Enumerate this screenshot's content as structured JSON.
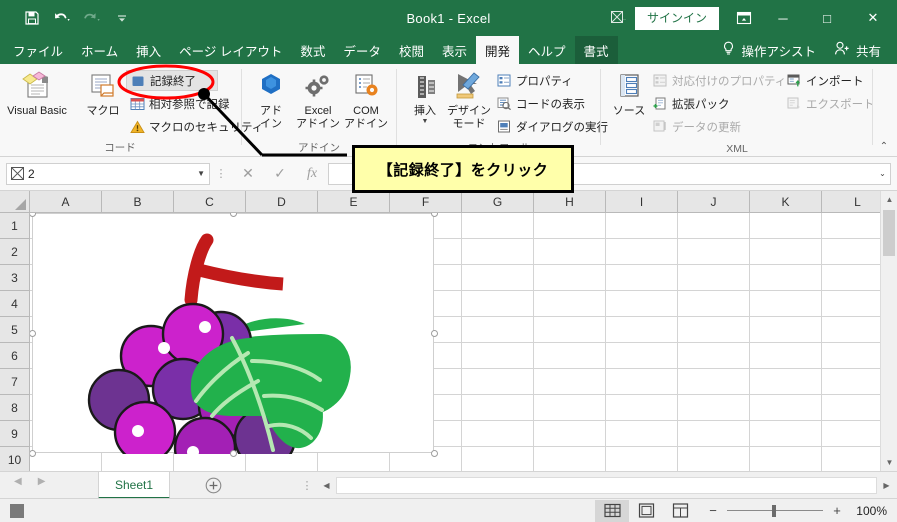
{
  "window": {
    "title": "Book1  -  Excel",
    "signin_label": "サインイン",
    "minimize_label": "─",
    "maximize_label": "□",
    "close_label": "✕",
    "quick_access": [
      {
        "name": "save-icon",
        "tooltip": "上書き保存"
      },
      {
        "name": "undo-icon",
        "tooltip": "元に戻す"
      },
      {
        "name": "redo-icon",
        "tooltip": "やり直し"
      },
      {
        "name": "customize-qat-icon",
        "tooltip": "クイック アクセス ツール バーのユーザー設定"
      }
    ]
  },
  "tabs": [
    {
      "label": "ファイル",
      "active": false
    },
    {
      "label": "ホーム",
      "active": false
    },
    {
      "label": "挿入",
      "active": false
    },
    {
      "label": "ページ レイアウト",
      "active": false
    },
    {
      "label": "数式",
      "active": false
    },
    {
      "label": "データ",
      "active": false
    },
    {
      "label": "校閲",
      "active": false
    },
    {
      "label": "表示",
      "active": false
    },
    {
      "label": "開発",
      "active": true
    },
    {
      "label": "ヘルプ",
      "active": false
    },
    {
      "label": "書式",
      "active": false,
      "contextual": true
    }
  ],
  "tabs_right": {
    "assist_label": "操作アシスト",
    "share_label": "共有"
  },
  "ribbon": {
    "collapse_label": "⌃",
    "groups": [
      {
        "name": "code",
        "label": "コード",
        "big_buttons": [
          {
            "label_line1": "Visual Basic",
            "label_line2": "",
            "icon": "visual-basic-icon"
          },
          {
            "label_line1": "マクロ",
            "label_line2": "",
            "icon": "macro-icon"
          }
        ],
        "small_items": [
          {
            "label": "記録終了",
            "icon": "stop-recording-icon",
            "state": "hover"
          },
          {
            "label": "相対参照で記録",
            "icon": "relative-reference-icon",
            "state": "normal"
          },
          {
            "label": "マクロのセキュリティ",
            "icon": "macro-security-icon",
            "state": "normal"
          }
        ]
      },
      {
        "name": "addins",
        "label": "アドイン",
        "big_buttons": [
          {
            "label_line1": "アド",
            "label_line2": "イン",
            "icon": "addin-icon"
          },
          {
            "label_line1": "Excel",
            "label_line2": "アドイン",
            "icon": "excel-addin-icon"
          },
          {
            "label_line1": "COM",
            "label_line2": "アドイン",
            "icon": "com-addin-icon"
          }
        ],
        "small_items": []
      },
      {
        "name": "controls",
        "label": "コントロール",
        "big_buttons": [
          {
            "label_line1": "挿入",
            "label_line2": "",
            "icon": "insert-control-icon",
            "has_caret": true
          },
          {
            "label_line1": "デザイン",
            "label_line2": "モード",
            "icon": "design-mode-icon"
          }
        ],
        "small_items": [
          {
            "label": "プロパティ",
            "icon": "properties-icon",
            "state": "normal"
          },
          {
            "label": "コードの表示",
            "icon": "view-code-icon",
            "state": "normal"
          },
          {
            "label": "ダイアログの実行",
            "icon": "run-dialog-icon",
            "state": "normal"
          }
        ]
      },
      {
        "name": "xml",
        "label": "XML",
        "big_buttons": [
          {
            "label_line1": "ソース",
            "label_line2": "",
            "icon": "xml-source-icon"
          }
        ],
        "small_items": [
          {
            "label": "対応付けのプロパティ",
            "icon": "map-properties-icon",
            "state": "disabled"
          },
          {
            "label": "拡張パック",
            "icon": "expansion-pack-icon",
            "state": "normal"
          },
          {
            "label": "データの更新",
            "icon": "refresh-data-icon",
            "state": "disabled"
          },
          {
            "label": "インポート",
            "icon": "import-icon",
            "state": "normal"
          },
          {
            "label": "エクスポート",
            "icon": "export-icon",
            "state": "disabled"
          }
        ]
      }
    ]
  },
  "formula_bar": {
    "name_box_value": "2",
    "name_box_icon": "picture-object-icon",
    "cancel_label": "✕",
    "enter_label": "✓",
    "function_label": "fx",
    "formula_value": "",
    "expand_label": "⌄"
  },
  "grid": {
    "columns": [
      "A",
      "B",
      "C",
      "D",
      "E",
      "F",
      "G",
      "H",
      "I",
      "J",
      "K",
      "L"
    ],
    "rows": [
      "1",
      "2",
      "3",
      "4",
      "5",
      "6",
      "7",
      "8",
      "9",
      "10"
    ],
    "selected_object": "図 2",
    "picture_alt": "ぶどうのイラスト"
  },
  "sheet_bar": {
    "prev_label": "◀",
    "next_label": "▶",
    "sheets": [
      {
        "label": "Sheet1",
        "active": true
      }
    ],
    "add_sheet_label": "+"
  },
  "status_bar": {
    "stop_recording_tooltip": "記録終了",
    "views": [
      {
        "name": "normal-view-icon",
        "active": true
      },
      {
        "name": "page-layout-view-icon",
        "active": false
      },
      {
        "name": "page-break-preview-icon",
        "active": false
      }
    ],
    "zoom_out_label": "−",
    "zoom_in_label": "+",
    "zoom_level": "100%"
  },
  "annotation": {
    "callout_text": "【記録終了】をクリック",
    "callout_bg": "#ffffaa",
    "callout_border": "#000000",
    "highlight_color": "#ff0000"
  },
  "colors": {
    "excel_green": "#217346",
    "ribbon_bg": "#f8f8f8",
    "header_bg": "#e6e6e6"
  }
}
